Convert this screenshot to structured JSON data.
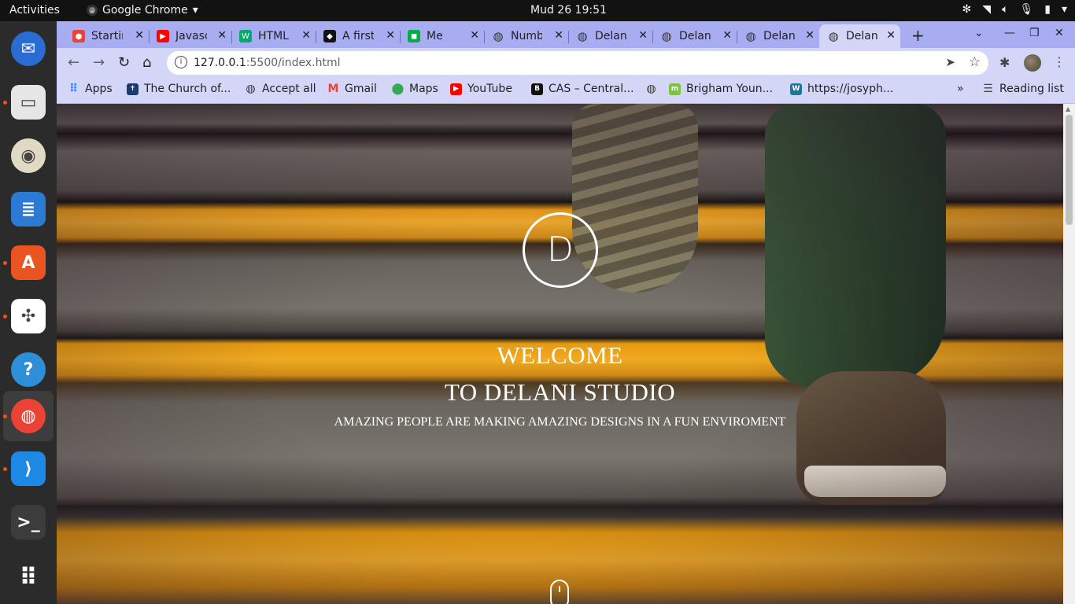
{
  "topbar": {
    "activities": "Activities",
    "app_name": "Google Chrome",
    "clock": "Mud 26  19:51"
  },
  "dock": {
    "items": [
      {
        "name": "thunderbird-icon",
        "color": "#2a6bd4"
      },
      {
        "name": "files-icon",
        "color": "#e6e6e6"
      },
      {
        "name": "rhythmbox-icon",
        "color": "#e0d9c4"
      },
      {
        "name": "libreoffice-writer-icon",
        "color": "#2b7bd4"
      },
      {
        "name": "ubuntu-software-icon",
        "color": "#e95420"
      },
      {
        "name": "slack-icon",
        "color": "#ffffff"
      },
      {
        "name": "help-icon",
        "color": "#2e8fd8"
      },
      {
        "name": "chrome-icon",
        "color": "#ea4335"
      },
      {
        "name": "vscode-icon",
        "color": "#1e88e5"
      },
      {
        "name": "terminal-icon",
        "color": "#3c3c3c"
      },
      {
        "name": "show-apps-icon",
        "color": "#ffffff"
      }
    ]
  },
  "tabs": [
    {
      "label": "Starting",
      "icon": "chrome-favicon",
      "color": "#ea4335"
    },
    {
      "label": "Javascript",
      "icon": "youtube-favicon",
      "color": "#ff0000"
    },
    {
      "label": "HTML",
      "icon": "w3-favicon",
      "color": "#04aa6d"
    },
    {
      "label": "A first",
      "icon": "page-favicon",
      "color": "#111111"
    },
    {
      "label": "Me",
      "icon": "meet-favicon",
      "color": "#00ac47"
    },
    {
      "label": "Number",
      "icon": "globe-favicon",
      "color": "#555555"
    },
    {
      "label": "Delani",
      "icon": "globe-favicon",
      "color": "#555555"
    },
    {
      "label": "Delani",
      "icon": "globe-favicon",
      "color": "#555555"
    },
    {
      "label": "Delani",
      "icon": "globe-favicon",
      "color": "#555555"
    },
    {
      "label": "Delani",
      "icon": "globe-favicon",
      "color": "#555555"
    }
  ],
  "toolbar": {
    "url_host": "127.0.0.1",
    "url_rest": ":5500/index.html"
  },
  "bookmarks": [
    {
      "label": "Apps",
      "icon": "apps-grid-icon",
      "color": "#4285f4"
    },
    {
      "label": "The Church of...",
      "icon": "church-icon",
      "color": "#1b3b6f"
    },
    {
      "label": "Accept all",
      "icon": "globe-icon",
      "color": "#333333"
    },
    {
      "label": "Gmail",
      "icon": "gmail-icon",
      "color": "#ea4335"
    },
    {
      "label": "Maps",
      "icon": "maps-icon",
      "color": "#34a853"
    },
    {
      "label": "YouTube",
      "icon": "youtube-icon",
      "color": "#ff0000"
    },
    {
      "label": "CAS – Central...",
      "icon": "byu-icon",
      "color": "#111111"
    },
    {
      "label": "",
      "icon": "globe-icon",
      "color": "#333333"
    },
    {
      "label": "Brigham Youn...",
      "icon": "byu-pathway-icon",
      "color": "#7bc442"
    },
    {
      "label": "https://josyph...",
      "icon": "wordpress-icon",
      "color": "#21759b"
    }
  ],
  "reading_list": "Reading list",
  "hero": {
    "logo_letter": "D",
    "title_line1": "WELCOME",
    "title_line2": "TO DELANI STUDIO",
    "subtitle": "AMAZING PEOPLE ARE MAKING AMAZING DESIGNS IN A FUN ENVIROMENT"
  }
}
